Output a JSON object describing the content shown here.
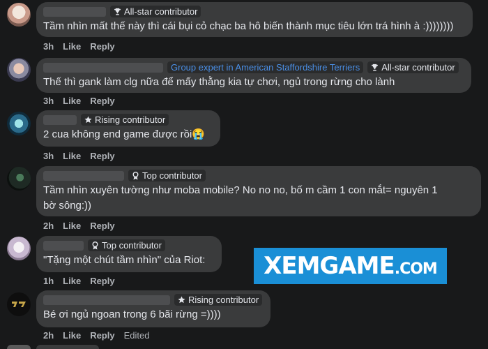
{
  "comments": [
    {
      "badges": [
        {
          "type": "trophy-icon",
          "label": "All-star contributor"
        }
      ],
      "text": "Tầm nhìn mất thế này thì cái bụi cỏ chạc ba hô biến thành mục tiêu lớn trá hình à :))))))))",
      "time": "3h",
      "like": "Like",
      "reply": "Reply"
    },
    {
      "badges": [
        {
          "type": "group",
          "label": "Group expert in American Staffordshire Terriers"
        },
        {
          "type": "trophy-icon",
          "label": "All-star contributor"
        }
      ],
      "text": "Thế thì gank làm clg nữa để mấy thằng kia tự chơi, ngủ trong rừng cho lành",
      "time": "3h",
      "like": "Like",
      "reply": "Reply"
    },
    {
      "badges": [
        {
          "type": "star-icon",
          "label": "Rising contributor"
        }
      ],
      "text": "2 cua không end game được rồi😭",
      "time": "3h",
      "like": "Like",
      "reply": "Reply"
    },
    {
      "badges": [
        {
          "type": "award-icon",
          "label": "Top contributor"
        }
      ],
      "text_line1": "Tầm nhìn xuyên tường như moba mobile? No no no, bố m cầm 1 con mắt= nguyên 1",
      "text_line2": "bờ sông:))",
      "time": "2h",
      "like": "Like",
      "reply": "Reply"
    },
    {
      "badges": [
        {
          "type": "award-icon",
          "label": "Top contributor"
        }
      ],
      "text": "\"Tặng một chút tầm nhìn\" của Riot:",
      "time": "1h",
      "like": "Like",
      "reply": "Reply"
    },
    {
      "badges": [
        {
          "type": "star-icon",
          "label": "Rising contributor"
        }
      ],
      "text": "Bé ơi ngủ ngoan trong 6 bãi rừng =))))",
      "time": "2h",
      "like": "Like",
      "reply": "Reply",
      "edited": "Edited"
    }
  ],
  "watermark": {
    "main": "XEMGAME",
    "suffix": ".COM"
  },
  "colors": {
    "background": "#18191a",
    "bubble": "#3a3b3c",
    "group_badge": "#4a8fe6",
    "watermark_bg": "#1a8fd6"
  }
}
